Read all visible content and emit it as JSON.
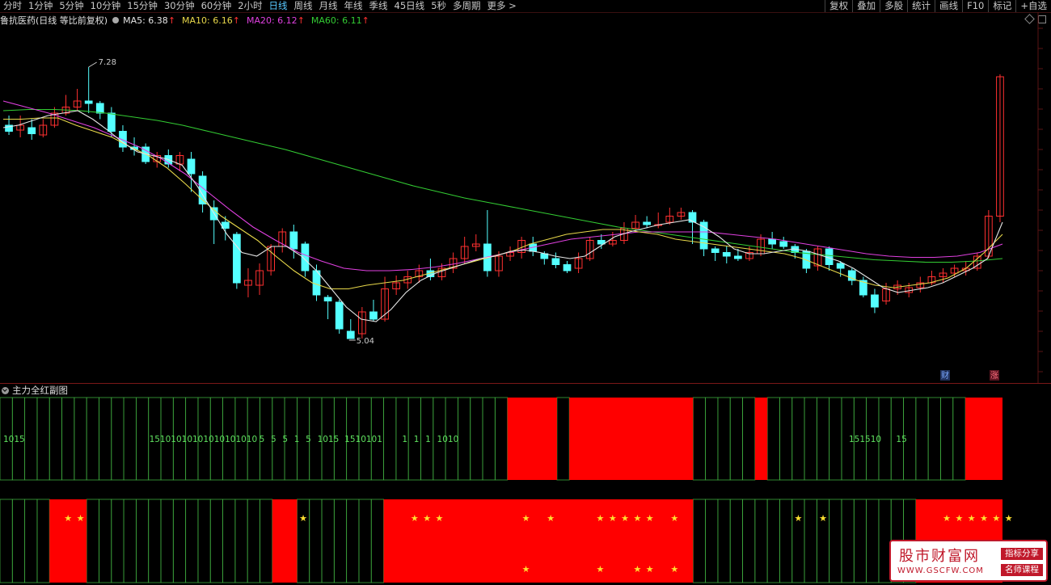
{
  "toolbar": {
    "periods": [
      "分时",
      "1分钟",
      "5分钟",
      "10分钟",
      "15分钟",
      "30分钟",
      "60分钟",
      "2小时",
      "日线",
      "周线",
      "月线",
      "年线",
      "季线",
      "45日线",
      "5秒",
      "多周期",
      "更多 >"
    ],
    "active_period": "日线",
    "tools": [
      "复权",
      "叠加",
      "多股",
      "统计",
      "画线",
      "F10",
      "标记",
      "+自选"
    ]
  },
  "info": {
    "stock_title": "鲁抗医药(日线 等比前复权)",
    "ma": [
      {
        "label": "MA5: 6.38",
        "color": "#e6e6e6"
      },
      {
        "label": "MA10: 6.16",
        "color": "#e8d84a"
      },
      {
        "label": "MA20: 6.12",
        "color": "#e040e0"
      },
      {
        "label": "MA60: 6.11",
        "color": "#33cc33"
      }
    ],
    "arrow": "↑"
  },
  "colors": {
    "up": "#ff3030",
    "down": "#54ffff",
    "ma5": "#e6e6e6",
    "ma10": "#e8d84a",
    "ma20": "#e040e0",
    "ma60": "#33cc33",
    "fill": "#ff0000",
    "grid": "#3ea83e"
  },
  "chart_data": {
    "type": "candlestick",
    "price_range": [
      4.8,
      7.6
    ],
    "high_label": "7.28",
    "low_label": "5.04",
    "candles": [
      [
        6.8,
        6.75,
        6.88,
        6.72
      ],
      [
        6.76,
        6.8,
        6.88,
        6.7
      ],
      [
        6.78,
        6.73,
        6.85,
        6.68
      ],
      [
        6.72,
        6.8,
        6.85,
        6.7
      ],
      [
        6.8,
        6.9,
        6.95,
        6.78
      ],
      [
        6.9,
        6.95,
        7.05,
        6.88
      ],
      [
        6.95,
        7.0,
        7.1,
        6.92
      ],
      [
        7.0,
        6.98,
        7.28,
        6.9
      ],
      [
        6.98,
        6.9,
        7.0,
        6.85
      ],
      [
        6.9,
        6.75,
        6.95,
        6.7
      ],
      [
        6.75,
        6.62,
        6.8,
        6.58
      ],
      [
        6.62,
        6.6,
        6.7,
        6.55
      ],
      [
        6.62,
        6.5,
        6.65,
        6.48
      ],
      [
        6.5,
        6.55,
        6.58,
        6.45
      ],
      [
        6.55,
        6.48,
        6.6,
        6.45
      ],
      [
        6.48,
        6.55,
        6.58,
        6.42
      ],
      [
        6.52,
        6.4,
        6.58,
        6.25
      ],
      [
        6.38,
        6.15,
        6.42,
        6.08
      ],
      [
        6.12,
        6.02,
        6.18,
        5.82
      ],
      [
        6.0,
        5.95,
        6.05,
        5.85
      ],
      [
        5.9,
        5.5,
        5.92,
        5.45
      ],
      [
        5.48,
        5.52,
        5.62,
        5.38
      ],
      [
        5.48,
        5.6,
        5.66,
        5.4
      ],
      [
        5.6,
        5.8,
        5.82,
        5.56
      ],
      [
        5.8,
        5.92,
        5.95,
        5.75
      ],
      [
        5.92,
        5.78,
        5.98,
        5.7
      ],
      [
        5.82,
        5.6,
        5.84,
        5.55
      ],
      [
        5.6,
        5.4,
        5.65,
        5.35
      ],
      [
        5.38,
        5.35,
        5.4,
        5.2
      ],
      [
        5.34,
        5.12,
        5.36,
        5.08
      ],
      [
        5.1,
        5.04,
        5.2,
        5.04
      ],
      [
        5.08,
        5.26,
        5.3,
        5.04
      ],
      [
        5.26,
        5.2,
        5.36,
        5.18
      ],
      [
        5.2,
        5.45,
        5.55,
        5.18
      ],
      [
        5.45,
        5.5,
        5.56,
        5.4
      ],
      [
        5.5,
        5.55,
        5.6,
        5.45
      ],
      [
        5.55,
        5.6,
        5.65,
        5.5
      ],
      [
        5.6,
        5.55,
        5.7,
        5.52
      ],
      [
        5.55,
        5.62,
        5.66,
        5.52
      ],
      [
        5.62,
        5.7,
        5.75,
        5.58
      ],
      [
        5.7,
        5.8,
        5.88,
        5.66
      ],
      [
        5.8,
        5.82,
        5.9,
        5.76
      ],
      [
        5.82,
        5.6,
        6.1,
        5.55
      ],
      [
        5.6,
        5.72,
        5.76,
        5.55
      ],
      [
        5.72,
        5.75,
        5.8,
        5.68
      ],
      [
        5.75,
        5.85,
        5.88,
        5.7
      ],
      [
        5.82,
        5.76,
        5.88,
        5.72
      ],
      [
        5.74,
        5.7,
        5.76,
        5.65
      ],
      [
        5.7,
        5.65,
        5.75,
        5.62
      ],
      [
        5.65,
        5.6,
        5.68,
        5.58
      ],
      [
        5.62,
        5.7,
        5.75,
        5.58
      ],
      [
        5.7,
        5.85,
        5.88,
        5.68
      ],
      [
        5.85,
        5.82,
        5.9,
        5.78
      ],
      [
        5.82,
        5.85,
        5.92,
        5.8
      ],
      [
        5.85,
        5.95,
        6.0,
        5.82
      ],
      [
        5.95,
        6.0,
        6.06,
        5.92
      ],
      [
        6.0,
        5.98,
        6.05,
        5.95
      ],
      [
        5.98,
        5.98,
        6.08,
        5.95
      ],
      [
        6.0,
        6.05,
        6.12,
        5.98
      ],
      [
        6.05,
        6.08,
        6.12,
        6.02
      ],
      [
        6.08,
        6.0,
        6.1,
        5.82
      ],
      [
        6.0,
        5.78,
        6.02,
        5.72
      ],
      [
        5.78,
        5.75,
        5.8,
        5.68
      ],
      [
        5.75,
        5.72,
        5.8,
        5.66
      ],
      [
        5.72,
        5.7,
        5.78,
        5.68
      ],
      [
        5.7,
        5.75,
        5.8,
        5.68
      ],
      [
        5.74,
        5.86,
        5.9,
        5.72
      ],
      [
        5.86,
        5.82,
        5.92,
        5.78
      ],
      [
        5.84,
        5.8,
        5.88,
        5.78
      ],
      [
        5.8,
        5.75,
        5.82,
        5.7
      ],
      [
        5.76,
        5.62,
        5.78,
        5.58
      ],
      [
        5.64,
        5.78,
        5.8,
        5.6
      ],
      [
        5.78,
        5.65,
        5.8,
        5.6
      ],
      [
        5.66,
        5.62,
        5.68,
        5.55
      ],
      [
        5.6,
        5.52,
        5.62,
        5.48
      ],
      [
        5.52,
        5.4,
        5.55,
        5.38
      ],
      [
        5.4,
        5.3,
        5.45,
        5.25
      ],
      [
        5.35,
        5.45,
        5.5,
        5.32
      ],
      [
        5.45,
        5.48,
        5.52,
        5.4
      ],
      [
        5.42,
        5.46,
        5.5,
        5.38
      ],
      [
        5.46,
        5.5,
        5.55,
        5.42
      ],
      [
        5.5,
        5.55,
        5.6,
        5.48
      ],
      [
        5.55,
        5.58,
        5.62,
        5.5
      ],
      [
        5.58,
        5.62,
        5.65,
        5.55
      ],
      [
        5.6,
        5.62,
        5.68,
        5.56
      ],
      [
        5.62,
        5.72,
        5.75,
        5.6
      ],
      [
        5.72,
        6.05,
        6.1,
        5.7
      ],
      [
        6.05,
        7.2,
        7.22,
        6.0
      ]
    ],
    "ma5": [
      6.78,
      6.8,
      6.84,
      6.88,
      6.9,
      6.92,
      6.85,
      6.76,
      6.66,
      6.58,
      6.55,
      6.52,
      6.47,
      6.3,
      6.1,
      5.9,
      5.75,
      5.72,
      5.8,
      5.8,
      5.72,
      5.6,
      5.45,
      5.3,
      5.2,
      5.18,
      5.28,
      5.42,
      5.52,
      5.58,
      5.62,
      5.66,
      5.7,
      5.72,
      5.76,
      5.77,
      5.75,
      5.72,
      5.7,
      5.72,
      5.8,
      5.88,
      5.92,
      5.95,
      5.98,
      6.0,
      6.02,
      5.96,
      5.88,
      5.78,
      5.74,
      5.74,
      5.76,
      5.78,
      5.76,
      5.72,
      5.68,
      5.62,
      5.54,
      5.46,
      5.42,
      5.44,
      5.46,
      5.5,
      5.56,
      5.62,
      5.7,
      6.0
    ],
    "ma10": [
      6.85,
      6.85,
      6.86,
      6.86,
      6.8,
      6.75,
      6.7,
      6.62,
      6.55,
      6.45,
      6.32,
      6.18,
      6.05,
      5.95,
      5.85,
      5.72,
      5.6,
      5.5,
      5.45,
      5.45,
      5.48,
      5.5,
      5.52,
      5.56,
      5.6,
      5.64,
      5.68,
      5.72,
      5.76,
      5.82,
      5.86,
      5.9,
      5.92,
      5.94,
      5.94,
      5.92,
      5.9,
      5.86,
      5.84,
      5.82,
      5.8,
      5.78,
      5.76,
      5.74,
      5.7,
      5.64,
      5.58,
      5.52,
      5.48,
      5.46,
      5.48,
      5.5,
      5.54,
      5.62,
      5.75,
      5.9
    ],
    "ma20": [
      7.0,
      6.95,
      6.9,
      6.84,
      6.78,
      6.7,
      6.62,
      6.52,
      6.4,
      6.25,
      6.1,
      5.96,
      5.85,
      5.75,
      5.68,
      5.62,
      5.6,
      5.6,
      5.61,
      5.63,
      5.66,
      5.7,
      5.74,
      5.78,
      5.82,
      5.86,
      5.88,
      5.9,
      5.92,
      5.92,
      5.92,
      5.92,
      5.9,
      5.88,
      5.86,
      5.83,
      5.8,
      5.77,
      5.74,
      5.72,
      5.71,
      5.71,
      5.72,
      5.75,
      5.82
    ],
    "ma60": [
      6.92,
      6.93,
      6.93,
      6.92,
      6.9,
      6.87,
      6.84,
      6.8,
      6.75,
      6.7,
      6.65,
      6.6,
      6.54,
      6.48,
      6.42,
      6.36,
      6.3,
      6.25,
      6.2,
      6.16,
      6.12,
      6.08,
      6.04,
      6.0,
      5.96,
      5.93,
      5.9,
      5.87,
      5.84,
      5.81,
      5.78,
      5.75,
      5.73,
      5.71,
      5.69,
      5.68,
      5.67,
      5.67,
      5.68,
      5.7
    ],
    "markers": [
      "财",
      "涨"
    ]
  },
  "sub_panel": {
    "title": "主力全红副图",
    "row1_numbers": [
      "1015",
      "",
      "",
      "",
      "",
      "",
      "",
      "",
      "",
      "15101010101010101010",
      "5",
      "5",
      "5",
      "1",
      "5",
      "1015",
      "1510101",
      "",
      "1",
      "1",
      "1",
      "1010"
    ],
    "row1_numbers_right": [
      "151510",
      "15"
    ],
    "row1_red": [
      [
        41,
        44
      ],
      [
        46,
        55
      ],
      [
        61,
        61
      ],
      [
        78,
        80
      ]
    ],
    "row2_red": [
      [
        4,
        6
      ],
      [
        22,
        23
      ],
      [
        31,
        55
      ],
      [
        74,
        80
      ]
    ],
    "row2_top_stars": [
      5,
      6,
      24,
      33,
      34,
      35,
      42,
      44,
      48,
      49,
      50,
      51,
      52,
      54,
      64,
      66,
      76,
      77,
      78,
      79,
      80,
      81
    ],
    "row2_bottom_stars": [
      42,
      48,
      51,
      52,
      54
    ]
  },
  "watermark": {
    "title": "股市财富网",
    "url": "WWW.GSCFW.COM",
    "tag1": "指标分享",
    "tag2": "名师课程"
  }
}
